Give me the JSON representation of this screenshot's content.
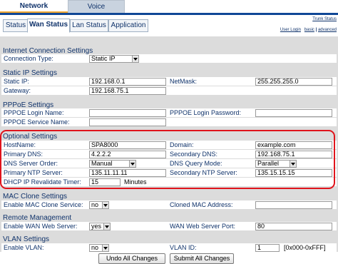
{
  "top_tabs": {
    "network": "Network",
    "voice": "Voice"
  },
  "sub_tabs": [
    "Status",
    "Wan Status",
    "Lan Status",
    "Application"
  ],
  "links": {
    "trunk_status": "Trunk Status",
    "user_login": "User Login",
    "basic": "basic",
    "sep": "|",
    "advanced": "advanced"
  },
  "sections": {
    "internet": {
      "title": "Internet Connection Settings",
      "conn_type_label": "Connection Type:",
      "conn_type_value": "Static IP"
    },
    "static_ip": {
      "title": "Static IP Settings",
      "ip_label": "Static IP:",
      "ip_value": "192.168.0.1",
      "netmask_label": "NetMask:",
      "netmask_value": "255.255.255.0",
      "gateway_label": "Gateway:",
      "gateway_value": "192.168.75.1"
    },
    "pppoe": {
      "title": "PPPoE Settings",
      "login_label": "PPPOE Login Name:",
      "login_value": "",
      "password_label": "PPPOE Login Password:",
      "password_value": "",
      "service_label": "PPPOE Service Name:",
      "service_value": ""
    },
    "optional": {
      "title": "Optional Settings",
      "hostname_label": "HostName:",
      "hostname_value": "SPA8000",
      "domain_label": "Domain:",
      "domain_value": "example.com",
      "pdns_label": "Primary DNS:",
      "pdns_value": "4.2.2.2",
      "sdns_label": "Secondary DNS:",
      "sdns_value": "192.168.75.1",
      "dns_order_label": "DNS Server Order:",
      "dns_order_value": "Manual",
      "dns_query_label": "DNS Query Mode:",
      "dns_query_value": "Parallel",
      "pntp_label": "Primary NTP Server:",
      "pntp_value": "135.11.11.11",
      "sntp_label": "Secondary NTP Server:",
      "sntp_value": "135.15.15.15",
      "dhcp_label": "DHCP IP Revalidate Timer:",
      "dhcp_value": "15",
      "dhcp_unit": "Minutes"
    },
    "mac": {
      "title": "MAC Clone Settings",
      "enable_label": "Enable MAC Clone Service:",
      "enable_value": "no",
      "cloned_label": "Cloned MAC Address:",
      "cloned_value": ""
    },
    "remote": {
      "title": "Remote Management",
      "enable_label": "Enable WAN Web Server:",
      "enable_value": "yes",
      "port_label": "WAN Web Server Port:",
      "port_value": "80"
    },
    "vlan": {
      "title": "VLAN Settings",
      "enable_label": "Enable VLAN:",
      "enable_value": "no",
      "id_label": "VLAN ID:",
      "id_value": "1",
      "id_range": "[0x000-0xFFF]"
    }
  },
  "buttons": {
    "undo": "Undo All Changes",
    "submit": "Submit All Changes"
  },
  "colors": {
    "nav_blue": "#0f4796",
    "accent_orange": "#f0a630",
    "text_blue": "#10336b",
    "highlight_red": "#e0141c",
    "panel_gray": "#dcdcdc"
  }
}
